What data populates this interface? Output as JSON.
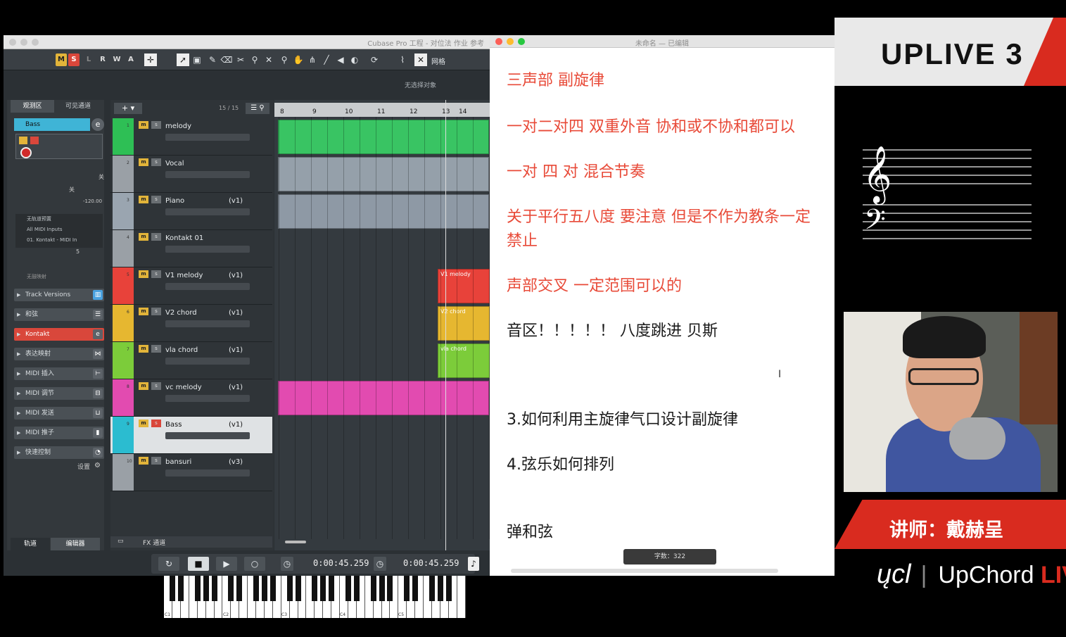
{
  "cubase": {
    "title": "Cubase Pro 工程 - 对位法 作业 参考",
    "no_selection": "无选择对象",
    "toolbar": {
      "m": "M",
      "s": "S",
      "l": "L",
      "r": "R",
      "w": "W",
      "a": "A",
      "grid": "网格"
    },
    "inspector": {
      "tab_observe": "观测区",
      "tab_visible": "可见通道",
      "track": "Bass",
      "vol_label": "关",
      "pan_label": "关",
      "db": "-120.00",
      "route1": "无轨道预置",
      "route2": "All MIDI Inputs",
      "route3": "01. Kontakt - MIDI In",
      "channel": "5",
      "no_drum_map": "无鼓映射",
      "sections": [
        "Track Versions",
        "和弦",
        "Kontakt",
        "表达映射",
        "MIDI 插入",
        "MIDI 调节",
        "MIDI 发送",
        "MIDI 推子",
        "快速控制"
      ],
      "settings": "设置",
      "tab_tracks": "轨道",
      "tab_editor": "编辑器"
    },
    "tracklist": {
      "count": "15 / 15",
      "fx": "FX 通道",
      "tracks": [
        {
          "num": "1",
          "name": "melody",
          "ver": ""
        },
        {
          "num": "2",
          "name": "Vocal",
          "ver": ""
        },
        {
          "num": "3",
          "name": "Piano",
          "ver": "(v1)"
        },
        {
          "num": "4",
          "name": "Kontakt 01",
          "ver": ""
        },
        {
          "num": "5",
          "name": "V1 melody",
          "ver": "(v1)"
        },
        {
          "num": "6",
          "name": "V2 chord",
          "ver": "(v1)"
        },
        {
          "num": "7",
          "name": "vla chord",
          "ver": "(v1)"
        },
        {
          "num": "8",
          "name": "vc melody",
          "ver": "(v1)"
        },
        {
          "num": "9",
          "name": "Bass",
          "ver": "(v1)"
        },
        {
          "num": "10",
          "name": "bansuri",
          "ver": "(v3)"
        }
      ]
    },
    "ruler": [
      "8",
      "9",
      "10",
      "11",
      "12",
      "13",
      "14"
    ],
    "parts": {
      "v1": "V1 melody",
      "v2": "V2 chord",
      "vla": "vla chord"
    },
    "transport": {
      "time1": "0:00:45.259",
      "time2": "0:00:45.259"
    },
    "keys": [
      "C1",
      "C2",
      "C3",
      "C4",
      "C5"
    ]
  },
  "editor": {
    "title": "未命名 — 已编辑",
    "lines": [
      {
        "text": "三声部 副旋律",
        "color": "red"
      },
      {
        "text": "一对二对四   双重外音 协和或不协和都可以",
        "color": "red"
      },
      {
        "text": "一对  四    对     混合节奏",
        "color": "red"
      },
      {
        "text": "关于平行五八度   要注意  但是不作为教条一定",
        "color": "red"
      },
      {
        "text": "禁止",
        "color": "red"
      },
      {
        "text": "声部交叉  一定范围可以的",
        "color": "red"
      },
      {
        "text": "音区！！！！！ 八度跳进  贝斯",
        "color": "black"
      },
      {
        "text": "3.如何利用主旋律气口设计副旋律",
        "color": "black"
      },
      {
        "text": "4.弦乐如何排列",
        "color": "black"
      },
      {
        "text": "弹和弦",
        "color": "black"
      }
    ],
    "wordcount": "字数：322"
  },
  "brand": {
    "banner": "UPLIVE 3",
    "teacher": "讲师：戴赫呈",
    "logo_up": "UpChord",
    "logo_live": "LIVE"
  }
}
